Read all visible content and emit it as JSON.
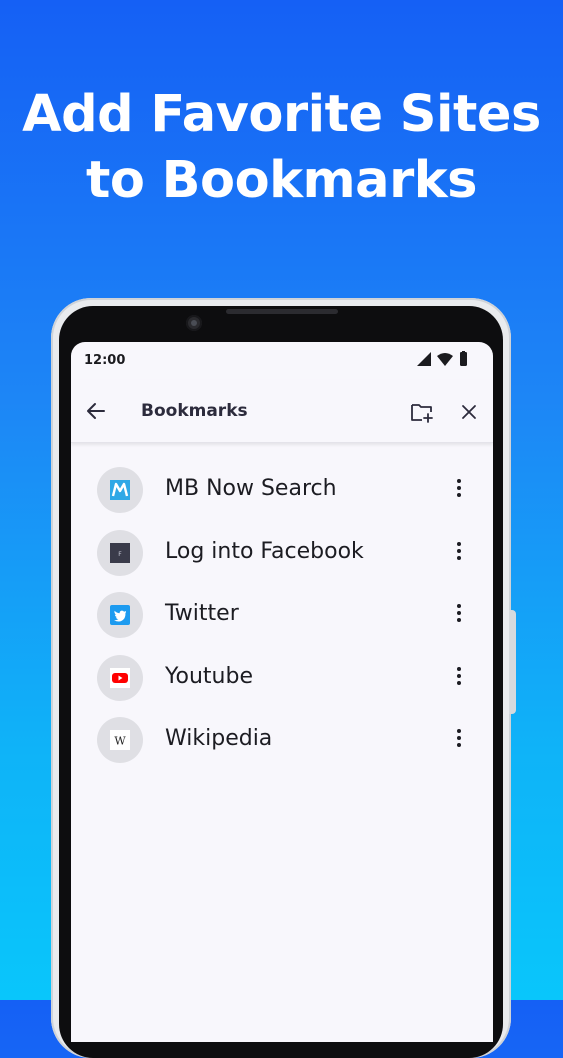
{
  "promo": {
    "headline_line1": "Add Favorite Sites",
    "headline_line2": "to Bookmarks"
  },
  "status_bar": {
    "time": "12:00"
  },
  "app_bar": {
    "title": "Bookmarks"
  },
  "bookmarks": [
    {
      "title": "MB Now Search",
      "icon": "mb-now-search-favicon",
      "color": "#2fa8e6"
    },
    {
      "title": "Log into Facebook",
      "icon": "facebook-favicon",
      "color": "#3a3b4a"
    },
    {
      "title": "Twitter",
      "icon": "twitter-favicon",
      "color": "#1d9bf0"
    },
    {
      "title": "Youtube",
      "icon": "youtube-favicon",
      "color": "#ff0000"
    },
    {
      "title": "Wikipedia",
      "icon": "wikipedia-favicon",
      "color": "#ffffff"
    }
  ],
  "icons": {
    "facebook_favicon_letter": "F",
    "wikipedia_favicon_letter": "W"
  },
  "colors": {
    "background_top": "#1560f5",
    "background_bottom": "#09c6fb",
    "screen_background": "#f8f7fc",
    "title_text": "#2c2b3c"
  }
}
